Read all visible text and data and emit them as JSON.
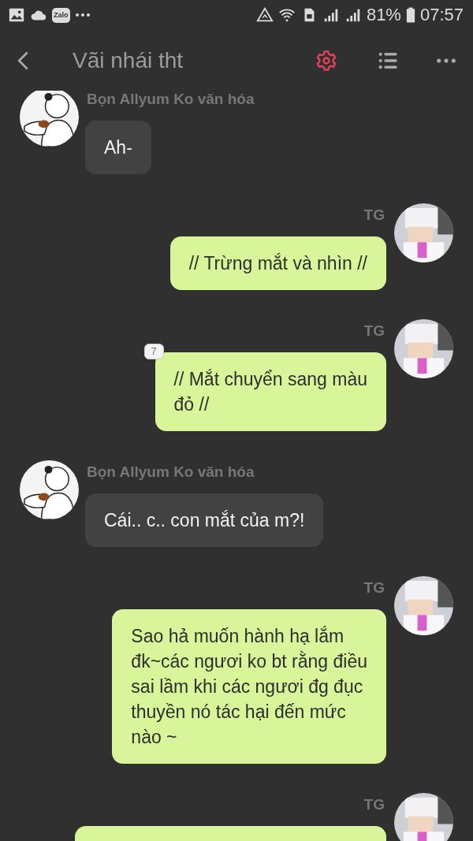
{
  "status_bar": {
    "notification_app": "Zalo",
    "battery": "81%",
    "time": "07:57"
  },
  "header": {
    "title": "Vãi nhái tht"
  },
  "messages": [
    {
      "kind": "incoming",
      "sender": "Bọn  Allyum Ko văn hóa",
      "text": "Ah-"
    },
    {
      "kind": "outgoing",
      "sender": "TG",
      "text": "// Trừng mắt và nhìn //"
    },
    {
      "kind": "outgoing",
      "sender": "TG",
      "text": "// Mắt chuyển sang màu\nđỏ //",
      "badge": "7"
    },
    {
      "kind": "incoming",
      "sender": "Bọn  Allyum Ko văn hóa",
      "text": "Cái.. c.. con mắt của m?!"
    },
    {
      "kind": "outgoing",
      "sender": "TG",
      "text": "Sao hả muốn hành hạ lắm\nđk~các ngươi ko bt rằng điều\nsai lầm khi các ngươi đg đục\nthuyền nó tác hại đến mức\nnào ~"
    },
    {
      "kind": "outgoing",
      "sender": "TG"
    }
  ]
}
